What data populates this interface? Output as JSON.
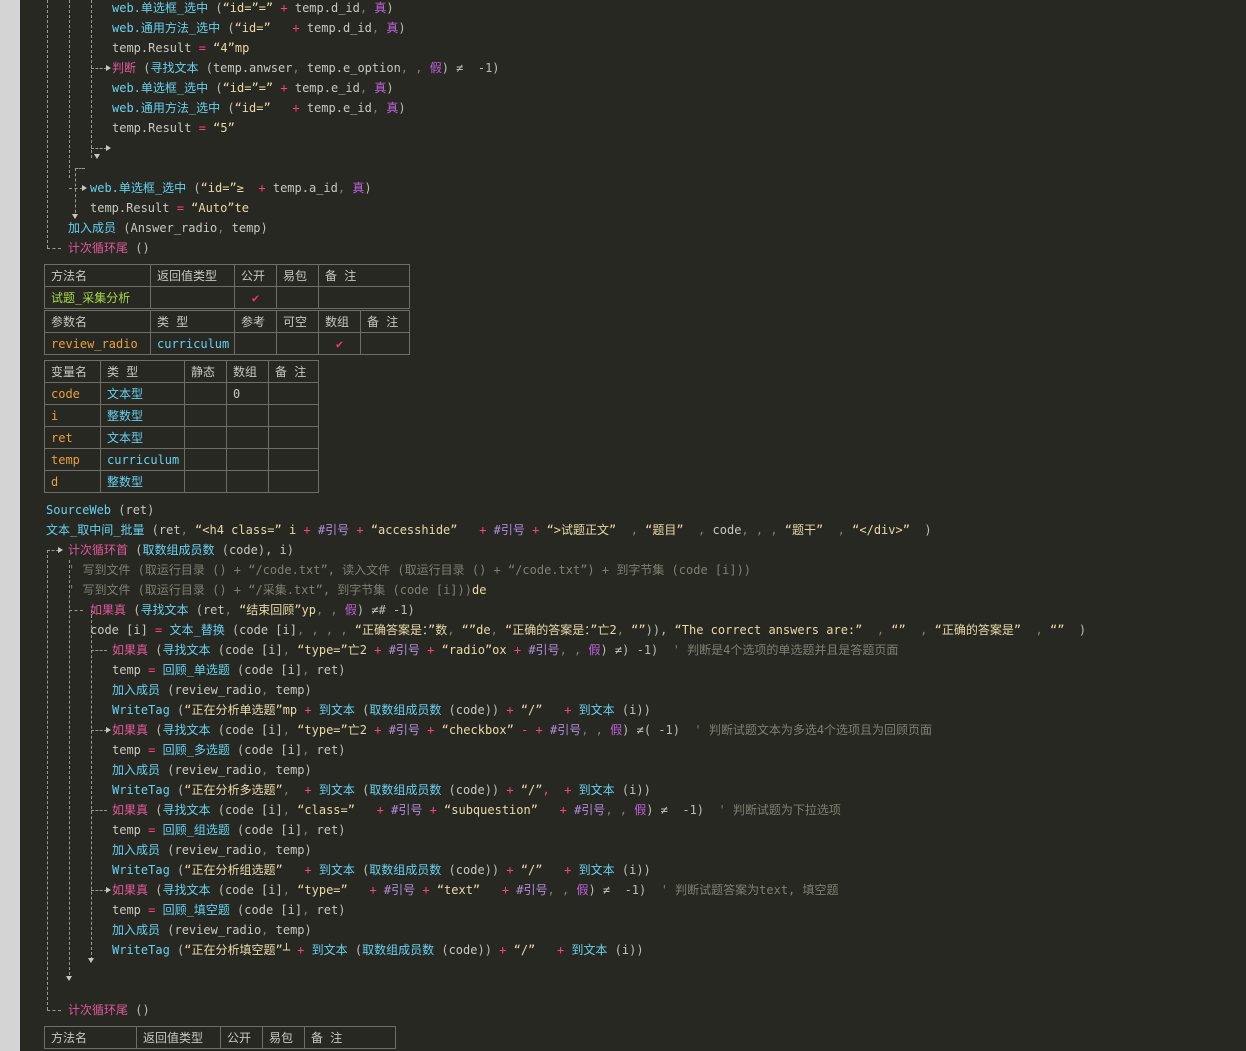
{
  "code_top": [
    [
      [
        "web.单选框_选中",
        "tok-fnb"
      ],
      [
        " (",
        "tok-punc"
      ],
      [
        "“id=”=”",
        "tok-str"
      ],
      [
        " + ",
        "tok-op"
      ],
      [
        "temp.d_id",
        "tok-var"
      ],
      [
        ", ",
        "tok-dim"
      ],
      [
        "真",
        "tok-bool"
      ],
      [
        ")",
        "tok-punc"
      ]
    ],
    [
      [
        "web.通用方法_选中",
        "tok-fnb"
      ],
      [
        " (",
        "tok-punc"
      ],
      [
        "“id=”",
        "tok-str"
      ],
      [
        "   + ",
        "tok-op"
      ],
      [
        "temp.d_id",
        "tok-var"
      ],
      [
        ", ",
        "tok-dim"
      ],
      [
        "真",
        "tok-bool"
      ],
      [
        ")",
        "tok-punc"
      ]
    ],
    [
      [
        "temp.Result",
        "tok-var"
      ],
      [
        " = ",
        "tok-op"
      ],
      [
        "“4”mp",
        "tok-str"
      ]
    ],
    [
      [
        "判断",
        "tok-kw"
      ],
      [
        " (",
        "tok-punc"
      ],
      [
        "寻找文本",
        "tok-fnb"
      ],
      [
        " (",
        "tok-punc"
      ],
      [
        "temp.anwser",
        "tok-var"
      ],
      [
        ", ",
        "tok-dim"
      ],
      [
        "temp.e_option",
        "tok-var"
      ],
      [
        ", , ",
        "tok-dim"
      ],
      [
        "假",
        "tok-bool"
      ],
      [
        ") ≠  -1)",
        "tok-punc"
      ]
    ],
    [
      [
        "web.单选框_选中",
        "tok-fnb"
      ],
      [
        " (",
        "tok-punc"
      ],
      [
        "“id=”=”",
        "tok-str"
      ],
      [
        " + ",
        "tok-op"
      ],
      [
        "temp.e_id",
        "tok-var"
      ],
      [
        ", ",
        "tok-dim"
      ],
      [
        "真",
        "tok-bool"
      ],
      [
        ")",
        "tok-punc"
      ]
    ],
    [
      [
        "web.通用方法_选中",
        "tok-fnb"
      ],
      [
        " (",
        "tok-punc"
      ],
      [
        "“id=”",
        "tok-str"
      ],
      [
        "   + ",
        "tok-op"
      ],
      [
        "temp.e_id",
        "tok-var"
      ],
      [
        ", ",
        "tok-dim"
      ],
      [
        "真",
        "tok-bool"
      ],
      [
        ")",
        "tok-punc"
      ]
    ],
    [
      [
        "temp.Result",
        "tok-var"
      ],
      [
        " = ",
        "tok-op"
      ],
      [
        "“5”",
        "tok-str"
      ]
    ]
  ],
  "code_mid": [
    [
      [
        "web.单选框_选中",
        "tok-fnb"
      ],
      [
        " (",
        "tok-punc"
      ],
      [
        "“id=”≥",
        "tok-str"
      ],
      [
        "  + ",
        "tok-op"
      ],
      [
        "temp.a_id",
        "tok-var"
      ],
      [
        ", ",
        "tok-dim"
      ],
      [
        "真",
        "tok-bool"
      ],
      [
        ")",
        "tok-punc"
      ]
    ],
    [
      [
        "temp.Result",
        "tok-var"
      ],
      [
        " = ",
        "tok-op"
      ],
      [
        "“Auto”te",
        "tok-str"
      ]
    ],
    [
      [
        "加入成员",
        "tok-fnb"
      ],
      [
        " (",
        "tok-punc"
      ],
      [
        "Answer_radio",
        "tok-var"
      ],
      [
        ", ",
        "tok-dim"
      ],
      [
        "temp",
        "tok-var"
      ],
      [
        ")",
        "tok-punc"
      ]
    ],
    [
      [
        "计次循环尾",
        "tok-kw"
      ],
      [
        " ()",
        "tok-punc"
      ]
    ]
  ],
  "method_table": {
    "headers": [
      "方法名",
      "返回值类型",
      "公开",
      "易包",
      "备 注"
    ],
    "row": [
      "试题_采集分析",
      "",
      "✔",
      "",
      ""
    ],
    "param_headers": [
      "参数名",
      "类 型",
      "参考",
      "可空",
      "数组",
      "备 注"
    ],
    "param_row": [
      "review_radio",
      "curriculum",
      "",
      "",
      "✔",
      ""
    ]
  },
  "var_table": {
    "headers": [
      "变量名",
      "类 型",
      "静态",
      "数组",
      "备 注"
    ],
    "rows": [
      [
        "code",
        "文本型",
        "",
        "0",
        ""
      ],
      [
        "i",
        "整数型",
        "",
        "",
        ""
      ],
      [
        "ret",
        "文本型",
        "",
        "",
        ""
      ],
      [
        "temp",
        "curriculum",
        "",
        "",
        ""
      ],
      [
        "d",
        "整数型",
        "",
        "",
        ""
      ]
    ]
  },
  "code_bottom": [
    [
      [
        "SourceWeb",
        "tok-fnb"
      ],
      [
        " (",
        "tok-punc"
      ],
      [
        "ret",
        "tok-var"
      ],
      [
        ")",
        "tok-punc"
      ]
    ],
    [
      [
        "文本_取中间_批量",
        "tok-fnb"
      ],
      [
        " (",
        "tok-punc"
      ],
      [
        "ret",
        "tok-var"
      ],
      [
        ", ",
        "tok-dim"
      ],
      [
        "“<h4 class=” i",
        "tok-str"
      ],
      [
        " + ",
        "tok-op"
      ],
      [
        "#引号",
        "tok-const"
      ],
      [
        " + ",
        "tok-op"
      ],
      [
        "“accesshide”",
        "tok-str"
      ],
      [
        "   + ",
        "tok-op"
      ],
      [
        "#引号",
        "tok-const"
      ],
      [
        " + ",
        "tok-op"
      ],
      [
        "“>试题正文”",
        "tok-str"
      ],
      [
        "  , ",
        "tok-dim"
      ],
      [
        "“题目”",
        "tok-str"
      ],
      [
        "  , ",
        "tok-dim"
      ],
      [
        "code",
        "tok-var"
      ],
      [
        ", , , ",
        "tok-dim"
      ],
      [
        "“题干”",
        "tok-str"
      ],
      [
        "  , ",
        "tok-dim"
      ],
      [
        "“</div>”",
        "tok-str"
      ],
      [
        "  )",
        "tok-punc"
      ]
    ],
    [
      [
        "计次循环首",
        "tok-kw"
      ],
      [
        " (",
        "tok-punc"
      ],
      [
        "取数组成员数",
        "tok-fnb"
      ],
      [
        " (",
        "tok-punc"
      ],
      [
        "code",
        "tok-var"
      ],
      [
        "), ",
        "tok-punc"
      ],
      [
        "i",
        "tok-var"
      ],
      [
        ")",
        "tok-punc"
      ]
    ],
    [
      [
        "' 写到文件 (取运行目录 () + “/code.txt”, 读入文件 (取运行目录 () + “/code.txt”) + 到字节集 (code [i]))",
        "tok-cmt"
      ]
    ],
    [
      [
        "' 写到文件 (取运行目录 () + “/采集.txt”, 到字节集 (code [i]))",
        "tok-cmt"
      ],
      [
        "de",
        "tok-str"
      ]
    ],
    [
      [
        "如果真",
        "tok-kw"
      ],
      [
        " (",
        "tok-punc"
      ],
      [
        "寻找文本",
        "tok-fnb"
      ],
      [
        " (",
        "tok-punc"
      ],
      [
        "ret",
        "tok-var"
      ],
      [
        ", ",
        "tok-dim"
      ],
      [
        "“结束回顾”yp",
        "tok-str"
      ],
      [
        ", , ",
        "tok-dim"
      ],
      [
        "假",
        "tok-bool"
      ],
      [
        ") ≠# -1)",
        "tok-punc"
      ]
    ],
    [
      [
        "code [i]",
        "tok-var"
      ],
      [
        " = ",
        "tok-op"
      ],
      [
        "文本_替换",
        "tok-fnb"
      ],
      [
        " (",
        "tok-punc"
      ],
      [
        "code [i]",
        "tok-var"
      ],
      [
        ", , , , ",
        "tok-dim"
      ],
      [
        "“正确答案是：”数",
        "tok-str"
      ],
      [
        ", ",
        "tok-dim"
      ],
      [
        "“”de",
        "tok-str"
      ],
      [
        ", ",
        "tok-dim"
      ],
      [
        "“正确的答案是：”亡2",
        "tok-str"
      ],
      [
        ", ",
        "tok-dim"
      ],
      [
        "“”",
        "tok-str"
      ],
      [
        ")), ",
        "tok-punc"
      ],
      [
        "“The correct answers are:”",
        "tok-str"
      ],
      [
        "  , ",
        "tok-dim"
      ],
      [
        "“”",
        "tok-str"
      ],
      [
        "  , ",
        "tok-dim"
      ],
      [
        "“正确的答案是”",
        "tok-str"
      ],
      [
        "  , ",
        "tok-dim"
      ],
      [
        "“”",
        "tok-str"
      ],
      [
        "  )",
        "tok-punc"
      ]
    ],
    [
      [
        "如果真",
        "tok-kw"
      ],
      [
        " (",
        "tok-punc"
      ],
      [
        "寻找文本",
        "tok-fnb"
      ],
      [
        " (",
        "tok-punc"
      ],
      [
        "code [i]",
        "tok-var"
      ],
      [
        ", ",
        "tok-dim"
      ],
      [
        "“type=”亡2",
        "tok-str"
      ],
      [
        " + ",
        "tok-op"
      ],
      [
        "#引号",
        "tok-const"
      ],
      [
        " + ",
        "tok-op"
      ],
      [
        "“radio”ox",
        "tok-str"
      ],
      [
        " + ",
        "tok-op"
      ],
      [
        "#引号",
        "tok-const"
      ],
      [
        ", , ",
        "tok-dim"
      ],
      [
        "假",
        "tok-bool"
      ],
      [
        ") ≠) -1)",
        "tok-punc"
      ],
      [
        "  ' 判断是4个选项的单选题并且是答题页面",
        "tok-cmt"
      ]
    ],
    [
      [
        "temp",
        "tok-var"
      ],
      [
        " = ",
        "tok-op"
      ],
      [
        "回顾_单选题",
        "tok-fnb"
      ],
      [
        " (",
        "tok-punc"
      ],
      [
        "code [i]",
        "tok-var"
      ],
      [
        ", ",
        "tok-dim"
      ],
      [
        "ret",
        "tok-var"
      ],
      [
        ")",
        "tok-punc"
      ]
    ],
    [
      [
        "加入成员",
        "tok-fnb"
      ],
      [
        " (",
        "tok-punc"
      ],
      [
        "review_radio",
        "tok-var"
      ],
      [
        ", ",
        "tok-dim"
      ],
      [
        "temp",
        "tok-var"
      ],
      [
        ")",
        "tok-punc"
      ]
    ],
    [
      [
        "WriteTag",
        "tok-fnb"
      ],
      [
        " (",
        "tok-punc"
      ],
      [
        "“正在分析单选题”mp",
        "tok-str"
      ],
      [
        " + ",
        "tok-op"
      ],
      [
        "到文本",
        "tok-fnb"
      ],
      [
        " (",
        "tok-punc"
      ],
      [
        "取数组成员数",
        "tok-fnb"
      ],
      [
        " (",
        "tok-punc"
      ],
      [
        "code",
        "tok-var"
      ],
      [
        ")) ",
        "tok-punc"
      ],
      [
        "+ ",
        "tok-op"
      ],
      [
        "“/”",
        "tok-str"
      ],
      [
        "   + ",
        "tok-op"
      ],
      [
        "到文本",
        "tok-fnb"
      ],
      [
        " (",
        "tok-punc"
      ],
      [
        "i",
        "tok-var"
      ],
      [
        "))",
        "tok-punc"
      ]
    ],
    [
      [
        "如果真",
        "tok-kw"
      ],
      [
        " (",
        "tok-punc"
      ],
      [
        "寻找文本",
        "tok-fnb"
      ],
      [
        " (",
        "tok-punc"
      ],
      [
        "code [i]",
        "tok-var"
      ],
      [
        ", ",
        "tok-dim"
      ],
      [
        "“type=”亡2",
        "tok-str"
      ],
      [
        " + ",
        "tok-op"
      ],
      [
        "#引号",
        "tok-const"
      ],
      [
        " + ",
        "tok-op"
      ],
      [
        "“checkbox”",
        "tok-str"
      ],
      [
        " - + ",
        "tok-op"
      ],
      [
        "#引号",
        "tok-const"
      ],
      [
        ", , ",
        "tok-dim"
      ],
      [
        "假",
        "tok-bool"
      ],
      [
        ") ≠( -1)",
        "tok-punc"
      ],
      [
        "  ' 判断试题文本为多选4个选项且为回顾页面",
        "tok-cmt"
      ]
    ],
    [
      [
        "temp",
        "tok-var"
      ],
      [
        " = ",
        "tok-op"
      ],
      [
        "回顾_多选题",
        "tok-fnb"
      ],
      [
        " (",
        "tok-punc"
      ],
      [
        "code [i]",
        "tok-var"
      ],
      [
        ", ",
        "tok-dim"
      ],
      [
        "ret",
        "tok-var"
      ],
      [
        ")",
        "tok-punc"
      ]
    ],
    [
      [
        "加入成员",
        "tok-fnb"
      ],
      [
        " (",
        "tok-punc"
      ],
      [
        "review_radio",
        "tok-var"
      ],
      [
        ", ",
        "tok-dim"
      ],
      [
        "temp",
        "tok-var"
      ],
      [
        ")",
        "tok-punc"
      ]
    ],
    [
      [
        "WriteTag",
        "tok-fnb"
      ],
      [
        " (",
        "tok-punc"
      ],
      [
        "“正在分析多选题”",
        "tok-str"
      ],
      [
        ", ",
        "tok-dim"
      ],
      [
        " + ",
        "tok-op"
      ],
      [
        "到文本",
        "tok-fnb"
      ],
      [
        " (",
        "tok-punc"
      ],
      [
        "取数组成员数",
        "tok-fnb"
      ],
      [
        " (",
        "tok-punc"
      ],
      [
        "code",
        "tok-var"
      ],
      [
        ")) ",
        "tok-punc"
      ],
      [
        "+ ",
        "tok-op"
      ],
      [
        "“/”",
        "tok-str"
      ],
      [
        ",  + ",
        "tok-op"
      ],
      [
        "到文本",
        "tok-fnb"
      ],
      [
        " (",
        "tok-punc"
      ],
      [
        "i",
        "tok-var"
      ],
      [
        "))",
        "tok-punc"
      ]
    ],
    [
      [
        "如果真",
        "tok-kw"
      ],
      [
        " (",
        "tok-punc"
      ],
      [
        "寻找文本",
        "tok-fnb"
      ],
      [
        " (",
        "tok-punc"
      ],
      [
        "code [i]",
        "tok-var"
      ],
      [
        ", ",
        "tok-dim"
      ],
      [
        "“class=”",
        "tok-str"
      ],
      [
        "   + ",
        "tok-op"
      ],
      [
        "#引号",
        "tok-const"
      ],
      [
        " + ",
        "tok-op"
      ],
      [
        "“subquestion”",
        "tok-str"
      ],
      [
        "   + ",
        "tok-op"
      ],
      [
        "#引号",
        "tok-const"
      ],
      [
        ", , ",
        "tok-dim"
      ],
      [
        "假",
        "tok-bool"
      ],
      [
        ") ≠  -1)",
        "tok-punc"
      ],
      [
        "  ' 判断试题为下拉选项",
        "tok-cmt"
      ]
    ],
    [
      [
        "temp",
        "tok-var"
      ],
      [
        " = ",
        "tok-op"
      ],
      [
        "回顾_组选题",
        "tok-fnb"
      ],
      [
        " (",
        "tok-punc"
      ],
      [
        "code [i]",
        "tok-var"
      ],
      [
        ", ",
        "tok-dim"
      ],
      [
        "ret",
        "tok-var"
      ],
      [
        ")",
        "tok-punc"
      ]
    ],
    [
      [
        "加入成员",
        "tok-fnb"
      ],
      [
        " (",
        "tok-punc"
      ],
      [
        "review_radio",
        "tok-var"
      ],
      [
        ", ",
        "tok-dim"
      ],
      [
        "temp",
        "tok-var"
      ],
      [
        ")",
        "tok-punc"
      ]
    ],
    [
      [
        "WriteTag",
        "tok-fnb"
      ],
      [
        " (",
        "tok-punc"
      ],
      [
        "“正在分析组选题”",
        "tok-str"
      ],
      [
        "   + ",
        "tok-op"
      ],
      [
        "到文本",
        "tok-fnb"
      ],
      [
        " (",
        "tok-punc"
      ],
      [
        "取数组成员数",
        "tok-fnb"
      ],
      [
        " (",
        "tok-punc"
      ],
      [
        "code",
        "tok-var"
      ],
      [
        ")) ",
        "tok-punc"
      ],
      [
        "+ ",
        "tok-op"
      ],
      [
        "“/”",
        "tok-str"
      ],
      [
        "   + ",
        "tok-op"
      ],
      [
        "到文本",
        "tok-fnb"
      ],
      [
        " (",
        "tok-punc"
      ],
      [
        "i",
        "tok-var"
      ],
      [
        "))",
        "tok-punc"
      ]
    ],
    [
      [
        "如果真",
        "tok-kw"
      ],
      [
        " (",
        "tok-punc"
      ],
      [
        "寻找文本",
        "tok-fnb"
      ],
      [
        " (",
        "tok-punc"
      ],
      [
        "code [i]",
        "tok-var"
      ],
      [
        ", ",
        "tok-dim"
      ],
      [
        "“type=”",
        "tok-str"
      ],
      [
        "   + ",
        "tok-op"
      ],
      [
        "#引号",
        "tok-const"
      ],
      [
        " + ",
        "tok-op"
      ],
      [
        "“text”",
        "tok-str"
      ],
      [
        "   + ",
        "tok-op"
      ],
      [
        "#引号",
        "tok-const"
      ],
      [
        ", , ",
        "tok-dim"
      ],
      [
        "假",
        "tok-bool"
      ],
      [
        ") ≠  -1)",
        "tok-punc"
      ],
      [
        "  ' 判断试题答案为text, 填空题",
        "tok-cmt"
      ]
    ],
    [
      [
        "temp",
        "tok-var"
      ],
      [
        " = ",
        "tok-op"
      ],
      [
        "回顾_填空题",
        "tok-fnb"
      ],
      [
        " (",
        "tok-punc"
      ],
      [
        "code [i]",
        "tok-var"
      ],
      [
        ", ",
        "tok-dim"
      ],
      [
        "ret",
        "tok-var"
      ],
      [
        ")",
        "tok-punc"
      ]
    ],
    [
      [
        "加入成员",
        "tok-fnb"
      ],
      [
        " (",
        "tok-punc"
      ],
      [
        "review_radio",
        "tok-var"
      ],
      [
        ", ",
        "tok-dim"
      ],
      [
        "temp",
        "tok-var"
      ],
      [
        ")",
        "tok-punc"
      ]
    ],
    [
      [
        "WriteTag",
        "tok-fnb"
      ],
      [
        " (",
        "tok-punc"
      ],
      [
        "“正在分析填空题”┴",
        "tok-str"
      ],
      [
        " + ",
        "tok-op"
      ],
      [
        "到文本",
        "tok-fnb"
      ],
      [
        " (",
        "tok-punc"
      ],
      [
        "取数组成员数",
        "tok-fnb"
      ],
      [
        " (",
        "tok-punc"
      ],
      [
        "code",
        "tok-var"
      ],
      [
        ")) ",
        "tok-punc"
      ],
      [
        "+ ",
        "tok-op"
      ],
      [
        "“/”",
        "tok-str"
      ],
      [
        "   + ",
        "tok-op"
      ],
      [
        "到文本",
        "tok-fnb"
      ],
      [
        " (",
        "tok-punc"
      ],
      [
        "i",
        "tok-var"
      ],
      [
        "))",
        "tok-punc"
      ]
    ],
    [
      [
        "计次循环尾",
        "tok-kw"
      ],
      [
        " ()",
        "tok-punc"
      ]
    ]
  ],
  "method_table_2": {
    "headers": [
      "方法名",
      "返回值类型",
      "公开",
      "易包",
      "备 注"
    ]
  }
}
